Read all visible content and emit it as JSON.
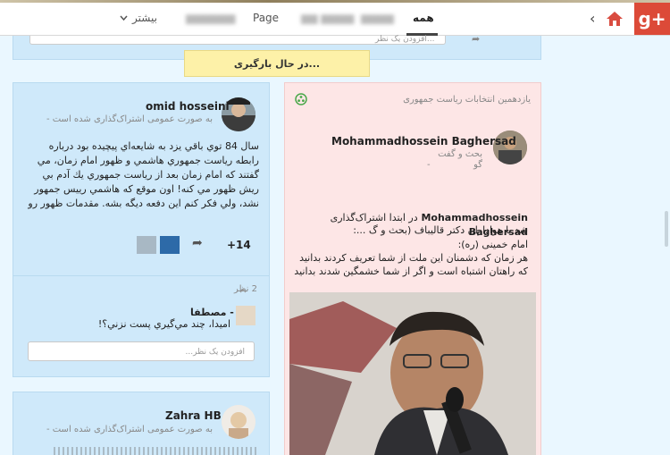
{
  "topbar": {
    "brand": "g+",
    "tabs": [
      {
        "label": "همه",
        "active": true
      },
      {
        "label": "",
        "blurred": true
      },
      {
        "label": "",
        "blurred": true
      },
      {
        "label": "Page"
      },
      {
        "label": "",
        "blurred": true
      },
      {
        "label": "بیشتر"
      }
    ]
  },
  "top_card": {
    "comment_placeholder": "افزودن یک نظر..."
  },
  "loading": {
    "text": "در حال بارگیری..."
  },
  "left_post_1": {
    "author": "omid hosseini",
    "visibility": "به صورت عمومی اشتراک‌گذاری شده است -",
    "body": "سال 84 توي باقي يزد به شايعه‌اي پيچيده بود درباره رابطه رياست جمهوري هاشمي و ظهور امام زمان، مي گفتند كه امام زمان بعد از رياست جمهوري يك آدم بي ريش ظهور مي كنه! اون موقع كه هاشمي رييس جمهور نشد، ولي فكر كنم اين دفعه ديگه بشه. مقدمات ظهور رو هم كه",
    "plus_count": "+14",
    "comments_count": "2 نظر",
    "comment_author": "مصطفا -",
    "comment_text": "اميدا، چند مي‌گيري پست نزني؟!",
    "comment_placeholder": "افزودن یک نظر..."
  },
  "left_post_2": {
    "author": "Zahra HB",
    "visibility": "به صورت عمومی اشتراک‌گذاری شده است -"
  },
  "right_post": {
    "community": "یازدهمین انتخابات ریاست جمهوری",
    "author": "Mohammadhossein Baghersad",
    "category": "بحث و گفت",
    "category2": "گو",
    "dash": "-",
    "shared_author": "Mohammadhossein Baghersad",
    "shared_line1": "در ابتدا اشتراک‌گذاری",
    "shared_line2": "شد با هواداران دکتر قالیباف (بحث و گ ...:",
    "quote_author": "امام خمینی (ره):",
    "quote_1": "هر زمان که دشمنان این ملت از شما تعریف کردند بدانید",
    "quote_2": "که راهتان اشتباه است و اگر از شما خشمگین شدند بدانید"
  },
  "colors": {
    "blue_card": "#cfe9fa",
    "pink_card": "#fde6e6",
    "loading": "#fdf1a8",
    "brand_red": "#dc4a38"
  }
}
